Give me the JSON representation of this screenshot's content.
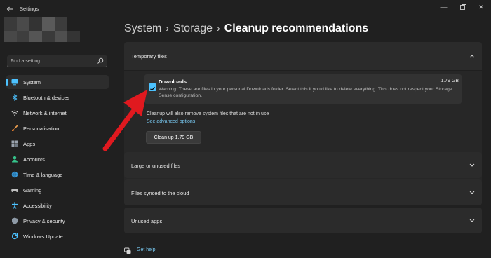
{
  "window": {
    "title": "Settings",
    "controls": [
      "minimize-icon",
      "maximize-icon",
      "close-icon"
    ]
  },
  "search": {
    "placeholder": "Find a setting",
    "icon": "search-icon"
  },
  "sidebar": {
    "items": [
      {
        "label": "System",
        "icon": "monitor-icon",
        "active": true
      },
      {
        "label": "Bluetooth & devices",
        "icon": "bluetooth-icon"
      },
      {
        "label": "Network & internet",
        "icon": "wifi-icon"
      },
      {
        "label": "Personalisation",
        "icon": "brush-icon"
      },
      {
        "label": "Apps",
        "icon": "apps-icon"
      },
      {
        "label": "Accounts",
        "icon": "person-icon"
      },
      {
        "label": "Time & language",
        "icon": "globe-clock-icon"
      },
      {
        "label": "Gaming",
        "icon": "controller-icon"
      },
      {
        "label": "Accessibility",
        "icon": "accessibility-icon"
      },
      {
        "label": "Privacy & security",
        "icon": "shield-icon"
      },
      {
        "label": "Windows Update",
        "icon": "update-icon"
      }
    ]
  },
  "breadcrumb": {
    "parts": [
      "System",
      "Storage"
    ],
    "current": "Cleanup recommendations"
  },
  "sections": {
    "temporary": {
      "title": "Temporary files",
      "expanded": true,
      "downloads": {
        "title": "Downloads",
        "size": "1.79 GB",
        "checked": true,
        "description": "Warning: These are files in your personal Downloads folder. Select this if you'd like to delete everything. This does not respect your Storage Sense configuration."
      },
      "note": "Cleanup will also remove system files that are not in use",
      "advanced_link": "See advanced options",
      "button": "Clean up 1.79 GB"
    },
    "large": {
      "title": "Large or unused files"
    },
    "synced": {
      "title": "Files synced to the cloud"
    },
    "unused": {
      "title": "Unused apps"
    }
  },
  "help": {
    "label": "Get help"
  },
  "colors": {
    "accent": "#4cc2ff",
    "link": "#78c8f0",
    "arrow": "#e0191f",
    "background": "#202020",
    "card": "#2b2b2b"
  }
}
